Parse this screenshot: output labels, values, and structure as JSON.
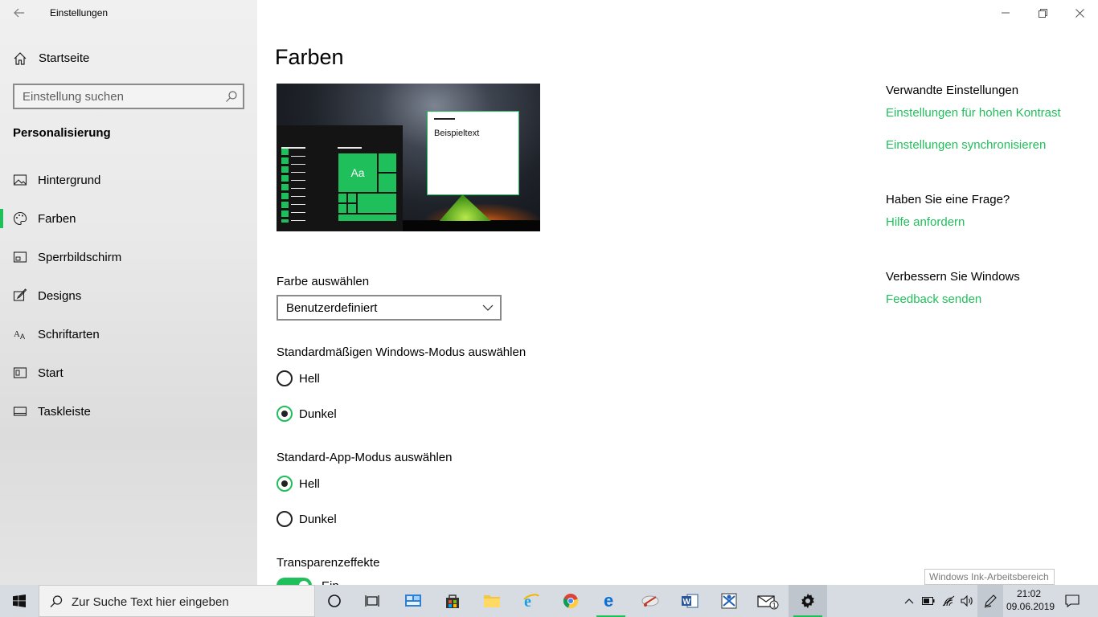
{
  "window": {
    "title": "Einstellungen"
  },
  "sidebar": {
    "home_label": "Startseite",
    "search_placeholder": "Einstellung suchen",
    "section_title": "Personalisierung",
    "items": [
      {
        "label": "Hintergrund",
        "icon": "picture-icon"
      },
      {
        "label": "Farben",
        "icon": "palette-icon",
        "active": true
      },
      {
        "label": "Sperrbildschirm",
        "icon": "lockscreen-icon"
      },
      {
        "label": "Designs",
        "icon": "brush-icon"
      },
      {
        "label": "Schriftarten",
        "icon": "font-icon"
      },
      {
        "label": "Start",
        "icon": "start-icon"
      },
      {
        "label": "Taskleiste",
        "icon": "taskbar-icon"
      }
    ]
  },
  "main": {
    "title": "Farben",
    "preview": {
      "sample_text": "Beispieltext",
      "tile_text": "Aa"
    },
    "color_select": {
      "label": "Farbe auswählen",
      "value": "Benutzerdefiniert"
    },
    "windows_mode": {
      "label": "Standardmäßigen Windows-Modus auswählen",
      "options": [
        "Hell",
        "Dunkel"
      ],
      "selected": "Dunkel"
    },
    "app_mode": {
      "label": "Standard-App-Modus auswählen",
      "options": [
        "Hell",
        "Dunkel"
      ],
      "selected": "Hell"
    },
    "transparency": {
      "label": "Transparenzeffekte",
      "state_label": "Ein",
      "on": true
    }
  },
  "related": {
    "heading": "Verwandte Einstellungen",
    "links": [
      "Einstellungen für hohen Kontrast",
      "Einstellungen synchronisieren"
    ],
    "question_heading": "Haben Sie eine Frage?",
    "question_link": "Hilfe anfordern",
    "improve_heading": "Verbessern Sie Windows",
    "improve_link": "Feedback senden"
  },
  "tooltip": "Windows Ink-Arbeitsbereich",
  "taskbar": {
    "search_placeholder": "Zur Suche Text hier eingeben",
    "mail_badge": "1",
    "time": "21:02",
    "date": "09.06.2019"
  },
  "colors": {
    "accent": "#1fbf5b",
    "taskbar": "#d7dce3"
  }
}
